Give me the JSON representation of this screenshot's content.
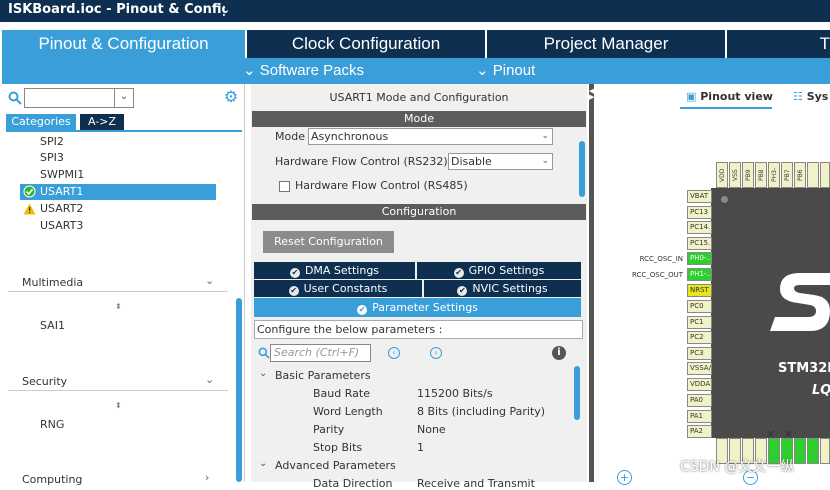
{
  "window": {
    "title": "ISKBoard.ioc - Pinout & Configur"
  },
  "main_tabs": [
    "Pinout & Configuration",
    "Clock Configuration",
    "Project Manager",
    "T"
  ],
  "sub_menu": [
    "Software Packs",
    "Pinout"
  ],
  "left_panel": {
    "tabs": [
      "Categories",
      "A->Z"
    ],
    "items": [
      "SPI2",
      "SPI3",
      "SWPMI1",
      "USART1",
      "USART2",
      "USART3"
    ],
    "groups": [
      {
        "name": "Multimedia",
        "items": [
          "SAI1"
        ]
      },
      {
        "name": "Security",
        "items": [
          "RNG"
        ]
      },
      {
        "name": "Computing",
        "items": []
      }
    ]
  },
  "usart_panel": {
    "title": "USART1 Mode and Configuration",
    "mode_header": "Mode",
    "mode_label": "Mode",
    "mode_value": "Asynchronous",
    "hw_flow_label": "Hardware Flow Control (RS232)",
    "hw_flow_value": "Disable",
    "rs485_label": "Hardware Flow Control (RS485)",
    "config_header": "Configuration",
    "reset_button": "Reset Configuration",
    "settings_tabs": [
      "DMA Settings",
      "GPIO Settings",
      "User Constants",
      "NVIC Settings",
      "Parameter Settings"
    ],
    "config_text": "Configure the below parameters :",
    "search_placeholder": "Search (Ctrl+F)",
    "basic_group": "Basic Parameters",
    "params": [
      {
        "name": "Baud Rate",
        "value": "115200 Bits/s"
      },
      {
        "name": "Word Length",
        "value": "8 Bits (including Parity)"
      },
      {
        "name": "Parity",
        "value": "None"
      },
      {
        "name": "Stop Bits",
        "value": "1"
      }
    ],
    "advanced_group": "Advanced Parameters",
    "partial_row": {
      "name": "Data Direction",
      "value": "Receive and Transmit"
    }
  },
  "right_panel": {
    "view_tabs": [
      "Pinout view",
      "Sys"
    ],
    "top_pins": [
      "VDD",
      "VSS",
      "PB9",
      "PB8",
      "PH3-",
      "PB7",
      "PB6"
    ],
    "left_pins": [
      "VBAT",
      "PC13",
      "PC14..",
      "PC15..",
      "PH0-..",
      "PH1-..",
      "NRST",
      "PC0",
      "PC1",
      "PC2",
      "PC3",
      "VSSA/..",
      "VDDA..",
      "PA0",
      "PA1",
      "PA2"
    ],
    "pin_labels": [
      "RCC_OSC_IN",
      "RCC_OSC_OUT"
    ],
    "chip_name": "STM32L",
    "chip_pkg": "LQ"
  },
  "watermark": "CSDN @文文一纵"
}
